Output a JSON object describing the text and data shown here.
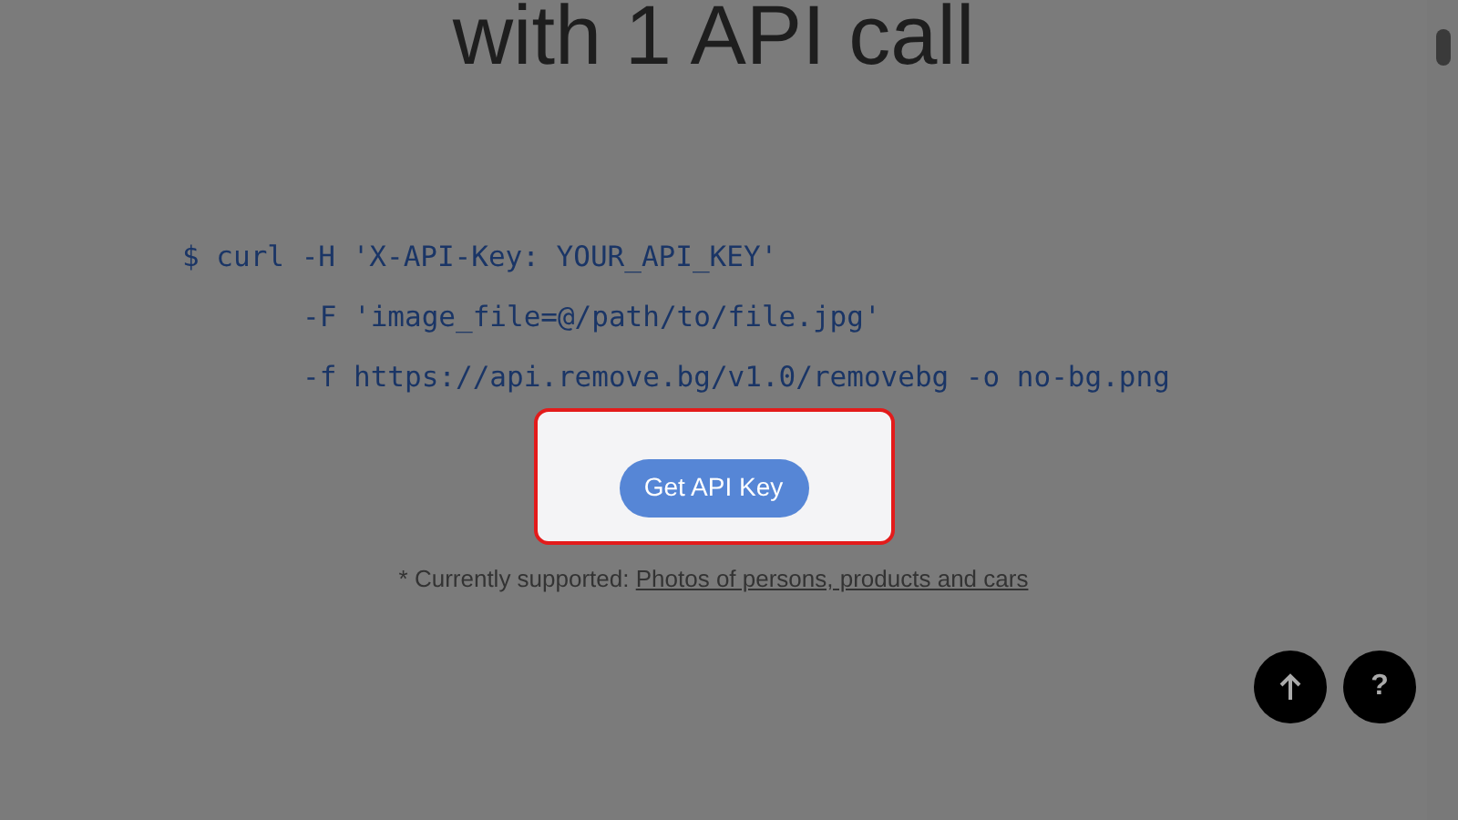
{
  "heading": "with 1 API call",
  "code_lines": [
    "$ curl -H 'X-API-Key: YOUR_API_KEY'",
    "-F 'image_file=@/path/to/file.jpg'",
    "-f https://api.remove.bg/v1.0/removebg -o no-bg.png"
  ],
  "cta_button": "Get API Key",
  "note": {
    "prefix": "* Currently supported: ",
    "link": "Photos of persons, products and cars"
  },
  "help_button": "?"
}
